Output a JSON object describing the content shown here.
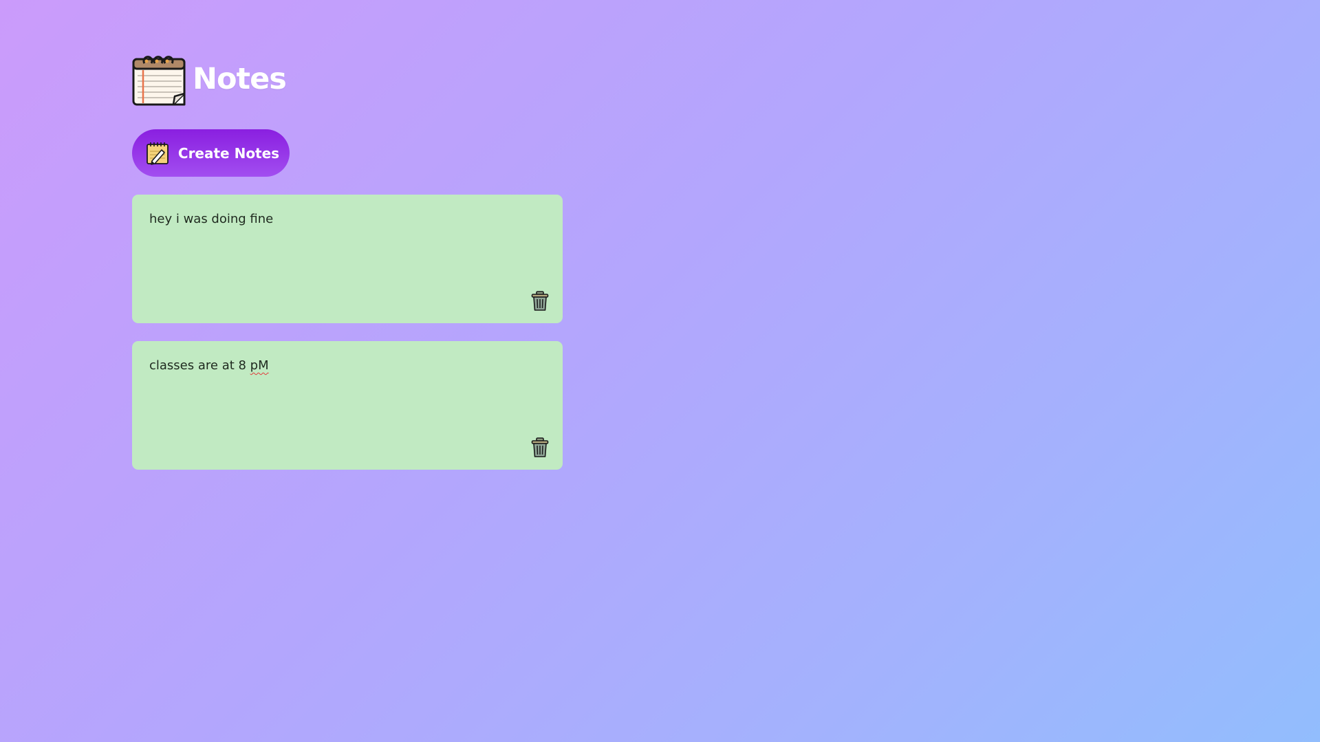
{
  "header": {
    "title": "Notes",
    "icon": "notepad-icon"
  },
  "toolbar": {
    "create_label": "Create Notes",
    "create_icon": "notepad-pencil-icon"
  },
  "notes": [
    {
      "text": "hey i was doing fine",
      "delete_icon": "trash-icon"
    },
    {
      "text_prefix": "classes are at 8 ",
      "text_flagged": "pM",
      "delete_icon": "trash-icon"
    }
  ],
  "colors": {
    "note_background": "#c1eac2",
    "button_gradient_start": "#8a1fe0",
    "button_gradient_end": "#a24ef0",
    "page_gradient_start": "#cb9bfb",
    "page_gradient_end": "#92bdfd",
    "spellcheck_underline": "#e23b3b"
  }
}
